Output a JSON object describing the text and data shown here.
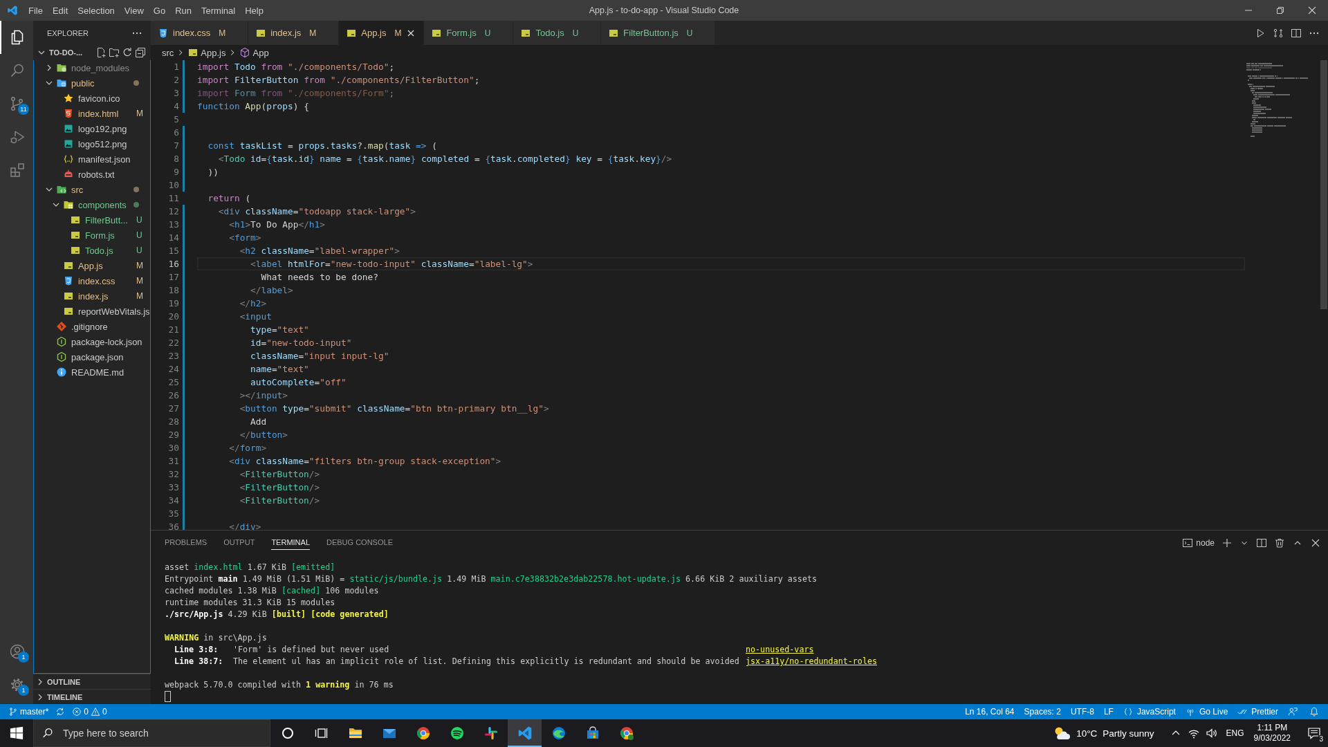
{
  "window": {
    "title": "App.js - to-do-app - Visual Studio Code"
  },
  "menu": [
    "File",
    "Edit",
    "Selection",
    "View",
    "Go",
    "Run",
    "Terminal",
    "Help"
  ],
  "activity_bar": {
    "items": [
      {
        "kind": "explorer",
        "selected": true
      },
      {
        "kind": "search",
        "selected": false
      },
      {
        "kind": "source-control",
        "selected": false,
        "badge": "11"
      },
      {
        "kind": "run",
        "selected": false
      },
      {
        "kind": "extensions",
        "selected": false
      }
    ],
    "bottom": [
      {
        "kind": "accounts",
        "badge": "1"
      },
      {
        "kind": "settings",
        "badge": "1"
      }
    ]
  },
  "explorer": {
    "title": "EXPLORER",
    "root": "TO-DO-...",
    "tree": [
      {
        "name": "node_modules",
        "kind": "node-folder",
        "expanded": false,
        "color": "#8c8c8c"
      },
      {
        "name": "public",
        "kind": "public-folder",
        "expanded": true,
        "color": "#e2c08d",
        "children": [
          {
            "name": "favicon.ico",
            "kind": "star"
          },
          {
            "name": "index.html",
            "kind": "html",
            "color": "#e2c08d",
            "badge": "M"
          },
          {
            "name": "logo192.png",
            "kind": "image"
          },
          {
            "name": "logo512.png",
            "kind": "image"
          },
          {
            "name": "manifest.json",
            "kind": "json"
          },
          {
            "name": "robots.txt",
            "kind": "robot"
          }
        ]
      },
      {
        "name": "src",
        "kind": "src-folder",
        "expanded": true,
        "color": "#e2c08d",
        "children": [
          {
            "name": "components",
            "kind": "components-folder",
            "expanded": true,
            "color": "#73c991",
            "children": [
              {
                "name": "FilterButt...",
                "kind": "js",
                "color": "#73c991",
                "badge": "U"
              },
              {
                "name": "Form.js",
                "kind": "js",
                "color": "#73c991",
                "badge": "U"
              },
              {
                "name": "Todo.js",
                "kind": "js",
                "color": "#73c991",
                "badge": "U"
              }
            ]
          },
          {
            "name": "App.js",
            "kind": "js",
            "color": "#e2c08d",
            "badge": "M"
          },
          {
            "name": "index.css",
            "kind": "css",
            "color": "#e2c08d",
            "badge": "M"
          },
          {
            "name": "index.js",
            "kind": "js",
            "color": "#e2c08d",
            "badge": "M"
          },
          {
            "name": "reportWebVitals.js",
            "kind": "js"
          }
        ]
      },
      {
        "name": ".gitignore",
        "kind": "git"
      },
      {
        "name": "package-lock.json",
        "kind": "npm"
      },
      {
        "name": "package.json",
        "kind": "npm"
      },
      {
        "name": "README.md",
        "kind": "info"
      }
    ],
    "sections": [
      {
        "title": "OUTLINE",
        "expanded": false
      },
      {
        "title": "TIMELINE",
        "expanded": false
      }
    ]
  },
  "tabs": [
    {
      "label": "index.css",
      "kind": "css",
      "color": "#e2c08d",
      "badge": "M",
      "selected": false
    },
    {
      "label": "index.js",
      "kind": "js",
      "color": "#e2c08d",
      "badge": "M",
      "selected": false
    },
    {
      "label": "App.js",
      "kind": "js",
      "color": "#e2c08d",
      "badge": "M",
      "selected": true
    },
    {
      "label": "Form.js",
      "kind": "js",
      "color": "#73c991",
      "badge": "U",
      "selected": false
    },
    {
      "label": "Todo.js",
      "kind": "js",
      "color": "#73c991",
      "badge": "U",
      "selected": false
    },
    {
      "label": "FilterButton.js",
      "kind": "js",
      "color": "#73c991",
      "badge": "U",
      "selected": false
    }
  ],
  "editor": {
    "breadcrumbs": [
      {
        "label": "src",
        "kind": "folder"
      },
      {
        "label": "App.js",
        "kind": "js"
      },
      {
        "label": "App",
        "kind": "component"
      }
    ],
    "lines": [
      {
        "number": "1",
        "changed": true,
        "current": false,
        "faded": false,
        "text": "import Todo from \"./components/Todo\";"
      },
      {
        "number": "2",
        "changed": true,
        "current": false,
        "faded": false,
        "text": "import FilterButton from \"./components/FilterButton\";"
      },
      {
        "number": "3",
        "changed": true,
        "current": false,
        "faded": true,
        "text": "import Form from \"./components/Form\";"
      },
      {
        "number": "4",
        "changed": true,
        "current": false,
        "faded": false,
        "text": "function App(props) {"
      },
      {
        "number": "5",
        "changed": false,
        "current": false
      },
      {
        "number": "6",
        "changed": true,
        "current": false
      },
      {
        "number": "7",
        "changed": true,
        "current": false,
        "faded": false,
        "text": "  const taskList = props.tasks?.map(task => ("
      },
      {
        "number": "8",
        "changed": true,
        "current": false,
        "faded": false,
        "text": "    <Todo id={task.id} name = {task.name} completed = {task.completed} key = {task.key}/>"
      },
      {
        "number": "9",
        "changed": true,
        "current": false,
        "faded": false,
        "text": "  ))"
      },
      {
        "number": "10",
        "changed": true,
        "current": false
      },
      {
        "number": "11",
        "changed": false,
        "current": false,
        "faded": false,
        "text": "  return ("
      },
      {
        "number": "12",
        "changed": true,
        "current": false,
        "faded": false,
        "text": "    <div className=\"todoapp stack-large\">"
      },
      {
        "number": "13",
        "changed": true,
        "current": false,
        "faded": false,
        "text": "      <h1>To Do App</h1>"
      },
      {
        "number": "14",
        "changed": true,
        "current": false,
        "faded": false,
        "text": "      <form>"
      },
      {
        "number": "15",
        "changed": true,
        "current": false,
        "faded": false,
        "text": "        <h2 className=\"label-wrapper\">"
      },
      {
        "number": "16",
        "changed": true,
        "current": true,
        "faded": false,
        "text": "          <label htmlFor=\"new-todo-input\" className=\"label-lg\">"
      },
      {
        "number": "17",
        "changed": true,
        "current": false,
        "faded": false,
        "text": "            What needs to be done?"
      },
      {
        "number": "18",
        "changed": true,
        "current": false,
        "faded": false,
        "text": "          </label>"
      },
      {
        "number": "19",
        "changed": true,
        "current": false,
        "faded": false,
        "text": "        </h2>"
      },
      {
        "number": "20",
        "changed": true,
        "current": false,
        "faded": false,
        "text": "        <input"
      },
      {
        "number": "21",
        "changed": true,
        "current": false,
        "faded": false,
        "text": "          type=\"text\""
      },
      {
        "number": "22",
        "changed": true,
        "current": false,
        "faded": false,
        "text": "          id=\"new-todo-input\""
      },
      {
        "number": "23",
        "changed": true,
        "current": false,
        "faded": false,
        "text": "          className=\"input input-lg\""
      },
      {
        "number": "24",
        "changed": true,
        "current": false,
        "faded": false,
        "text": "          name=\"text\""
      },
      {
        "number": "25",
        "changed": true,
        "current": false,
        "faded": false,
        "text": "          autoComplete=\"off\""
      },
      {
        "number": "26",
        "changed": true,
        "current": false,
        "faded": false,
        "text": "        ></input>"
      },
      {
        "number": "27",
        "changed": true,
        "current": false,
        "faded": false,
        "text": "        <button type=\"submit\" className=\"btn btn-primary btn__lg\">"
      },
      {
        "number": "28",
        "changed": true,
        "current": false,
        "faded": false,
        "text": "          Add"
      },
      {
        "number": "29",
        "changed": true,
        "current": false,
        "faded": false,
        "text": "        </button>"
      },
      {
        "number": "30",
        "changed": true,
        "current": false,
        "faded": false,
        "text": "      </form>"
      },
      {
        "number": "31",
        "changed": true,
        "current": false,
        "faded": false,
        "text": "      <div className=\"filters btn-group stack-exception\">"
      },
      {
        "number": "32",
        "changed": true,
        "current": false,
        "faded": false,
        "text": "        <FilterButton/>"
      },
      {
        "number": "33",
        "changed": true,
        "current": false,
        "faded": false,
        "text": "        <FilterButton/>"
      },
      {
        "number": "34",
        "changed": true,
        "current": false,
        "faded": false,
        "text": "        <FilterButton/>"
      },
      {
        "number": "35",
        "changed": true,
        "current": false
      },
      {
        "number": "36",
        "changed": true,
        "current": false,
        "faded": false,
        "text": "      </div>"
      }
    ]
  },
  "panel": {
    "tabs": [
      {
        "label": "PROBLEMS",
        "selected": false
      },
      {
        "label": "OUTPUT",
        "selected": false
      },
      {
        "label": "TERMINAL",
        "selected": true
      },
      {
        "label": "DEBUG CONSOLE",
        "selected": false
      }
    ],
    "terminal": {
      "name": "node",
      "lines": [
        {
          "kind": "text",
          "segments": [
            {
              "kind": "plain",
              "text": "asset"
            },
            {
              "kind": "path",
              "text": "index.html"
            },
            {
              "kind": "plain",
              "text": "1.67 KiB"
            },
            {
              "kind": "path",
              "text": "[emitted]"
            }
          ]
        },
        {
          "kind": "text",
          "segments": [
            {
              "kind": "plain",
              "text": "Entrypoint"
            },
            {
              "kind": "strong",
              "text": "main"
            },
            {
              "kind": "plain",
              "text": "1.49 MiB (1.51 MiB) ="
            },
            {
              "kind": "path",
              "text": "static/js/bundle.js"
            },
            {
              "kind": "plain",
              "text": "1.49 MiB"
            },
            {
              "kind": "path",
              "text": "main.c7e38832b2e3dab22578.hot-update.js"
            },
            {
              "kind": "plain",
              "text": "6.66 KiB 2 auxiliary assets"
            }
          ]
        },
        {
          "kind": "text",
          "segments": [
            {
              "kind": "plain",
              "text": "cached modules 1.38 MiB"
            },
            {
              "kind": "path",
              "text": "[cached]"
            },
            {
              "kind": "plain",
              "text": "106 modules"
            }
          ]
        },
        {
          "kind": "text",
          "segments": [
            {
              "kind": "plain",
              "text": "runtime modules 31.3 KiB 15 modules"
            }
          ]
        },
        {
          "kind": "text",
          "segments": [
            {
              "kind": "strong",
              "text": "./src/App.js"
            },
            {
              "kind": "plain",
              "text": "4.29 KiB"
            },
            {
              "kind": "highlight",
              "text": "[built] [code generated]"
            }
          ]
        },
        {
          "kind": "blank"
        },
        {
          "kind": "text",
          "segments": [
            {
              "kind": "highlight",
              "text": "WARNING"
            },
            {
              "kind": "plain",
              "text": "in src\\App.js"
            }
          ]
        },
        {
          "kind": "warning",
          "location": "Line 3:8:",
          "message": "'Form' is defined but never used",
          "rule": "no-unused-vars"
        },
        {
          "kind": "warning",
          "location": "Line 38:7:",
          "message": "The element ul has an implicit role of list. Defining this explicitly is redundant and should be avoided",
          "rule": "jsx-a11y/no-redundant-roles"
        },
        {
          "kind": "blank"
        },
        {
          "kind": "text",
          "segments": [
            {
              "kind": "plain",
              "text": "webpack 5.70.0 compiled with"
            },
            {
              "kind": "highlight",
              "text": "1 warning"
            },
            {
              "kind": "plain",
              "text": "in 76 ms"
            }
          ]
        },
        {
          "kind": "cursor"
        }
      ]
    }
  },
  "status_bar": {
    "branch": "master*",
    "errors": "0",
    "warnings": "0",
    "items": [
      {
        "kind": "position",
        "label": "Ln 16, Col 64"
      },
      {
        "kind": "indent",
        "label": "Spaces: 2"
      },
      {
        "kind": "encoding",
        "label": "UTF-8"
      },
      {
        "kind": "eol",
        "label": "LF"
      },
      {
        "kind": "language",
        "label": "JavaScript"
      },
      {
        "kind": "go-live",
        "label": "Go Live"
      },
      {
        "kind": "prettier",
        "label": "Prettier"
      },
      {
        "kind": "feedback"
      },
      {
        "kind": "notifications"
      }
    ]
  },
  "taskbar": {
    "search": {
      "placeholder": "Type here to search"
    },
    "apps": [
      {
        "kind": "cortana",
        "selected": false
      },
      {
        "kind": "task-view",
        "selected": false
      },
      {
        "kind": "file-explorer",
        "selected": false
      },
      {
        "kind": "mail",
        "selected": false
      },
      {
        "kind": "chrome",
        "selected": false
      },
      {
        "kind": "spotify",
        "selected": false
      },
      {
        "kind": "slack",
        "selected": false
      },
      {
        "kind": "vscode",
        "selected": true
      },
      {
        "kind": "edge",
        "selected": false
      },
      {
        "kind": "store",
        "selected": false
      },
      {
        "kind": "chrome-profile",
        "selected": false
      }
    ],
    "weather": {
      "temperature": "10°C",
      "condition": "Partly sunny"
    },
    "language": "ENG",
    "time": "1:11 PM",
    "date": "9/03/2022",
    "notifications": "3"
  }
}
